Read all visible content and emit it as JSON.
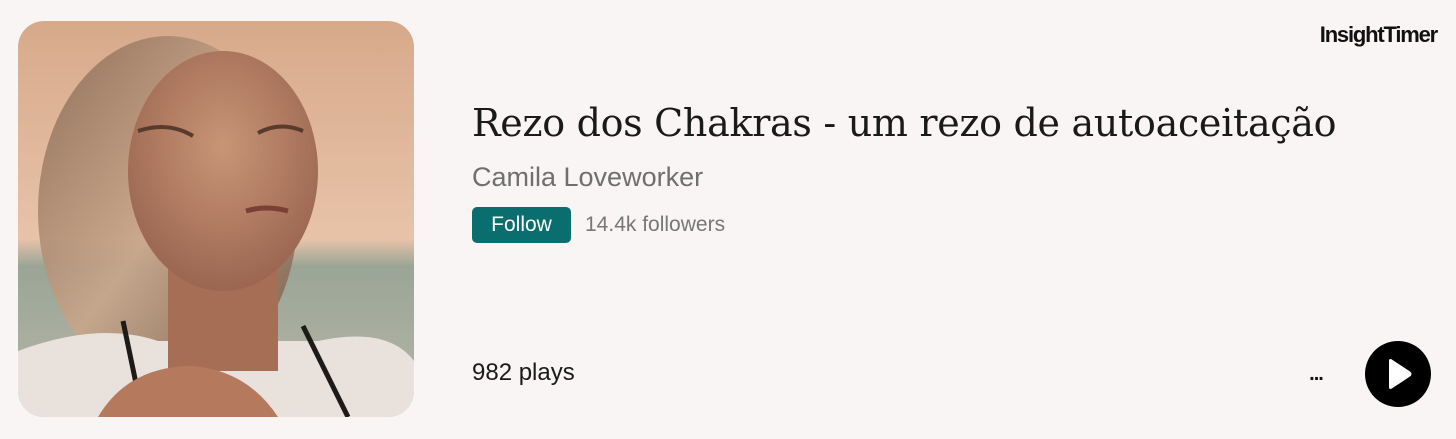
{
  "brand": {
    "name": "InsightTimer"
  },
  "track": {
    "title": "Rezo dos Chakras - um rezo de autoaceitação",
    "author": "Camila Loveworker",
    "follow_label": "Follow",
    "followers": "14.4k followers",
    "plays": "982 plays"
  },
  "controls": {
    "more_label": "...",
    "more_icon": "ellipsis-icon",
    "play_icon": "play-icon"
  },
  "colors": {
    "background": "#f8f5f4",
    "accent": "#0b6e6e",
    "play_button": "#000000"
  }
}
